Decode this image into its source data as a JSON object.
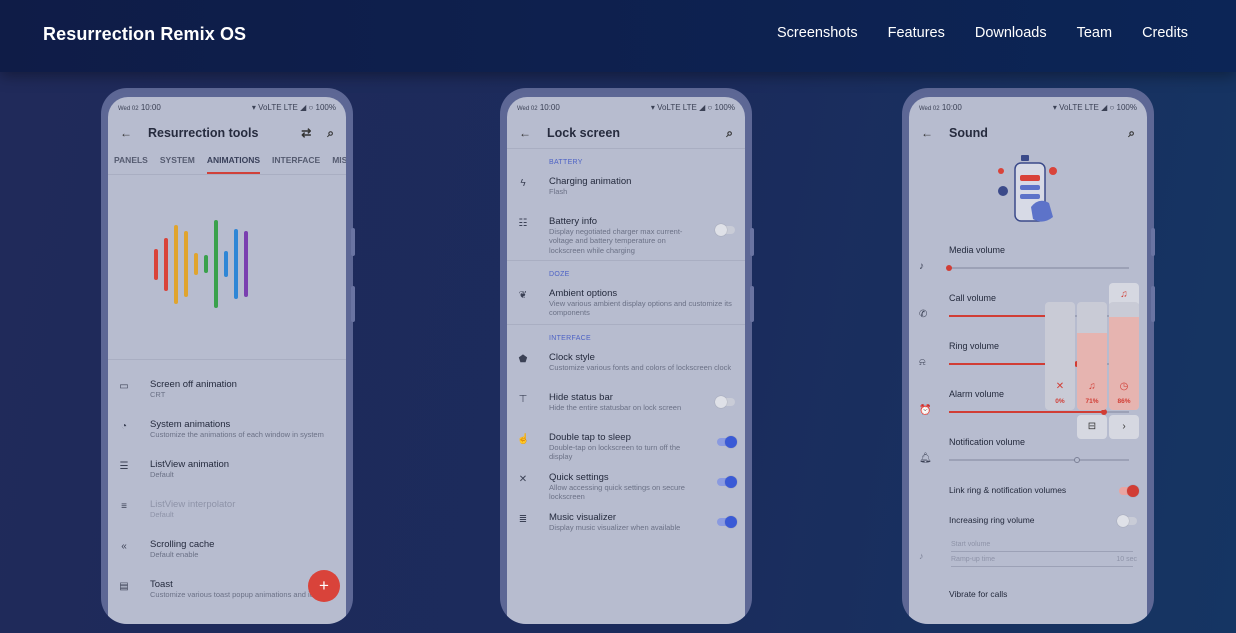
{
  "site": {
    "brand": "Resurrection Remix OS",
    "nav": [
      "Screenshots",
      "Features",
      "Downloads",
      "Team",
      "Credits"
    ]
  },
  "status_bar": {
    "date": "Wed 02",
    "time": "10:00",
    "signal": "VoLTE LTE",
    "battery": "100%"
  },
  "phone1": {
    "title": "Resurrection tools",
    "tabs": [
      "PANELS",
      "SYSTEM",
      "ANIMATIONS",
      "INTERFACE",
      "MISC"
    ],
    "active_tab": "ANIMATIONS",
    "bar_colors": [
      "#d9433a",
      "#d9433a",
      "#e0a42e",
      "#e0a42e",
      "#e0a42e",
      "#3aa14c",
      "#3aa14c",
      "#2f86d6",
      "#2f86d6",
      "#7a3fb0"
    ],
    "bar_values": [
      0.35,
      0.6,
      0.9,
      0.75,
      0.25,
      0.2,
      1.0,
      0.3,
      0.8,
      0.75
    ],
    "items": [
      {
        "title": "Screen off animation",
        "subtitle": "CRT",
        "icon": "screen-off-icon"
      },
      {
        "title": "System animations",
        "subtitle": "Customize the animations of each window in system",
        "icon": "animation-icon"
      },
      {
        "title": "ListView animation",
        "subtitle": "Default",
        "icon": "list-icon"
      },
      {
        "title": "ListView interpolator",
        "subtitle": "Default",
        "icon": "interpolator-icon"
      },
      {
        "title": "Scrolling cache",
        "subtitle": "Default enable",
        "icon": "scrolling-icon"
      },
      {
        "title": "Toast",
        "subtitle": "Customize various toast popup animations and icons",
        "icon": "toast-icon"
      }
    ],
    "fab": "+"
  },
  "phone2": {
    "title": "Lock screen",
    "sections": [
      {
        "header": "BATTERY",
        "items": [
          {
            "title": "Charging animation",
            "subtitle": "Flash",
            "icon": "bolt-icon",
            "toggle": null
          },
          {
            "title": "Battery info",
            "subtitle": "Display negotiated charger max current-voltage and battery temperature on lockscreen while charging",
            "icon": "battery-info-icon",
            "toggle": false
          }
        ]
      },
      {
        "header": "DOZE",
        "items": [
          {
            "title": "Ambient options",
            "subtitle": "View various ambient display options and customize its components",
            "icon": "leaf-icon",
            "toggle": null
          }
        ]
      },
      {
        "header": "INTERFACE",
        "items": [
          {
            "title": "Clock style",
            "subtitle": "Customize various fonts and colors of lockscreen clock",
            "icon": "clock-style-icon",
            "toggle": null
          },
          {
            "title": "Hide status bar",
            "subtitle": "Hide the entire statusbar on lock screen",
            "icon": "status-bar-icon",
            "toggle": false
          },
          {
            "title": "Double tap to sleep",
            "subtitle": "Double-tap on lockscreen to turn off the display",
            "icon": "tap-icon",
            "toggle": true
          },
          {
            "title": "Quick settings",
            "subtitle": "Allow accessing quick settings on secure lockscreen",
            "icon": "quick-settings-icon",
            "toggle": true
          },
          {
            "title": "Music visualizer",
            "subtitle": "Display music visualizer when available",
            "icon": "music-visualizer-icon",
            "toggle": true
          }
        ]
      }
    ]
  },
  "phone3": {
    "title": "Sound",
    "volumes": [
      {
        "label": "Media volume",
        "icon": "music-note-icon",
        "level": 0.0
      },
      {
        "label": "Call volume",
        "icon": "phone-icon",
        "level": 0.55
      },
      {
        "label": "Ring volume",
        "icon": "ring-icon",
        "level": 0.71
      },
      {
        "label": "Alarm volume",
        "icon": "alarm-icon",
        "level": 0.86
      },
      {
        "label": "Notification volume",
        "icon": "bell-icon",
        "level": 0.71
      }
    ],
    "panel": [
      {
        "icon": "mute-icon",
        "value": "0%",
        "level": 0.0
      },
      {
        "icon": "bell-icon",
        "value": "71%",
        "level": 0.71
      },
      {
        "icon": "alarm-icon",
        "value": "86%",
        "level": 0.86
      }
    ],
    "link_ring": {
      "title": "Link ring & notification volumes",
      "on": true
    },
    "increasing": {
      "title": "Increasing ring volume",
      "on": false
    },
    "start_volume": "Start volume",
    "ramp_up": "Ramp-up time",
    "ramp_value": "10 sec",
    "vibrate": "Vibrate for calls"
  }
}
